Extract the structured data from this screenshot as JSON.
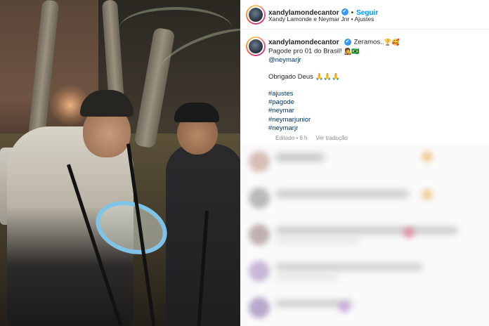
{
  "post": {
    "header": {
      "username": "xandylamondecantor",
      "verified_glyph": "✔",
      "separator": "•",
      "follow_label": "Seguir",
      "subtitle": "Xandy Lamonde e Neymar Jnr • Ajustes"
    },
    "caption": {
      "username": "xandylamondecantor",
      "verified_glyph": "✔",
      "line1_text": "Zeramos..",
      "line1_emoji": "🏆🥰",
      "line2_text": "Pagode pro 01 do Brasil!",
      "line2_emoji": "🧑‍🎤🇧🇷",
      "mention": "@neymarjr",
      "thanks": "Obrigado Deus 🙏🙏🙏",
      "hashtags": [
        "#ajustes",
        "#pagode",
        "#neymar",
        "#neymarjunior",
        "#neymarjr"
      ]
    },
    "meta": {
      "edited": "Editado • 6 h",
      "translate": "Ver tradução"
    }
  },
  "icons": {
    "verified": "verified-badge-icon",
    "avatar": "profile-avatar"
  },
  "colors": {
    "follow": "#0095f6",
    "hashtag": "#00376b",
    "verified": "#3897f0",
    "muted": "#8e8e8e"
  }
}
